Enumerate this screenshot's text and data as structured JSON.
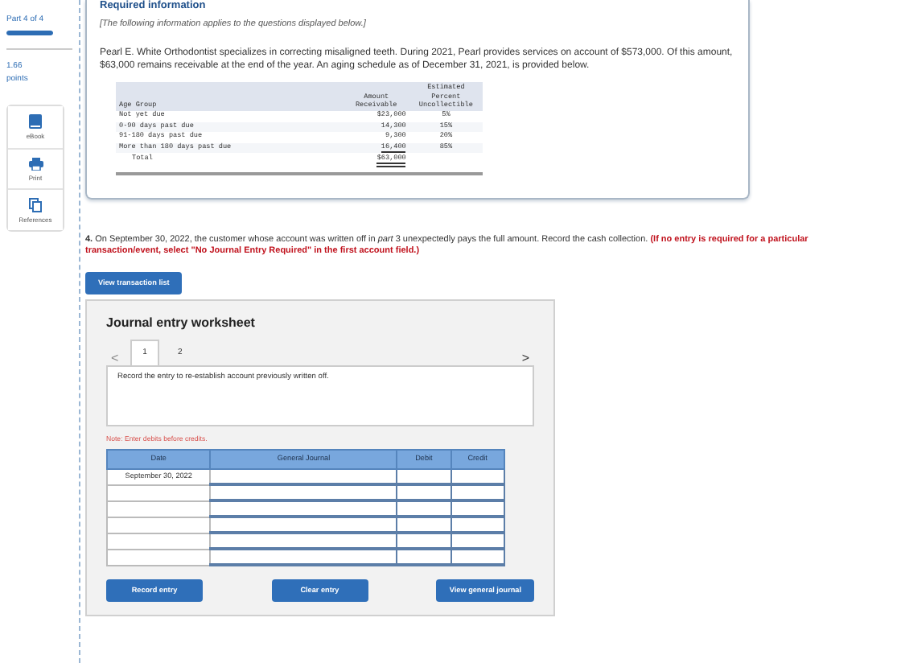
{
  "sidebar": {
    "part": "Part 4 of 4",
    "progress": {
      "level": 1
    },
    "points": "1.66",
    "points_label": "points",
    "tools": [
      {
        "kind": "book",
        "label": "eBook"
      },
      {
        "kind": "print",
        "label": "Print"
      },
      {
        "kind": "references",
        "label": "References"
      }
    ]
  },
  "required_info": {
    "title": "Required information",
    "note": "[The following information applies to the questions displayed below.]",
    "paragraph": "Pearl E. White Orthodontist specializes in correcting misaligned teeth. During 2021, Pearl provides services on account of $573,000. Of this amount, $63,000 remains receivable at the end of the year. An aging schedule as of December 31, 2021, is provided below.",
    "table": {
      "columns": [
        "Age Group",
        "Amount Receivable",
        "Estimated Percent Uncollectible"
      ],
      "rows": [
        [
          "Not yet due",
          "$23,000",
          "5%"
        ],
        [
          "0-90 days past due",
          "14,300",
          "15%"
        ],
        [
          "91-180 days past due",
          "9,300",
          "20%"
        ],
        [
          "More than 180 days past due",
          "16,400",
          "85%"
        ]
      ],
      "total": {
        "label": "Total",
        "amount": "$63,000"
      }
    }
  },
  "question": {
    "text": "**4.** On September 30, 2022, the customer whose account was written off in *part* 3 unexpectedly pays the full amount. Record the cash collection.",
    "instruction": "(If no entry is required for a particular transaction/event, select \"No Journal Entry Required\" in the first account field.)"
  },
  "view_transaction_button": "View transaction list",
  "worksheet": {
    "title": "Journal entry worksheet",
    "prev": "<",
    "next": ">",
    "tabs": [
      {
        "label": "1",
        "selected": true
      },
      {
        "label": "2",
        "selected": false
      }
    ],
    "instruction": "Record the entry to re-establish account previously written off.",
    "note": "Note: Enter debits before credits.",
    "columns": [
      "Date",
      "General Journal",
      "Debit",
      "Credit"
    ],
    "rows": [
      {
        "date": "September 30, 2022"
      },
      {},
      {},
      {},
      {},
      {}
    ],
    "buttons": [
      "Record entry",
      "Clear entry",
      "View general journal"
    ]
  }
}
